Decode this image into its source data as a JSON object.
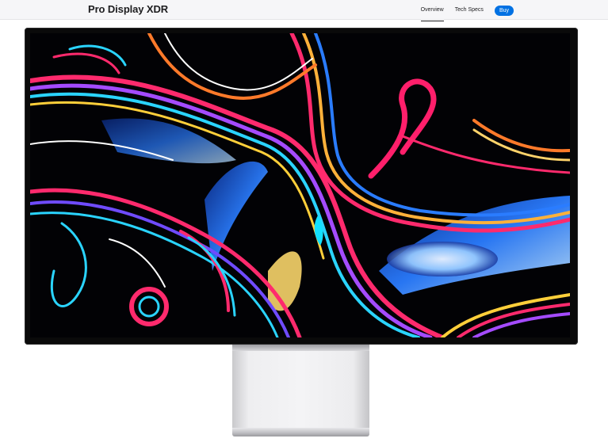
{
  "nav": {
    "product_title": "Pro Display XDR",
    "links": [
      "Overview",
      "Tech Specs"
    ],
    "active_link": "Overview",
    "buy_label": "Buy"
  },
  "colors": {
    "accent": "#0071e3",
    "nav_background": "#f6f6f8",
    "text": "#1d1d1f"
  }
}
